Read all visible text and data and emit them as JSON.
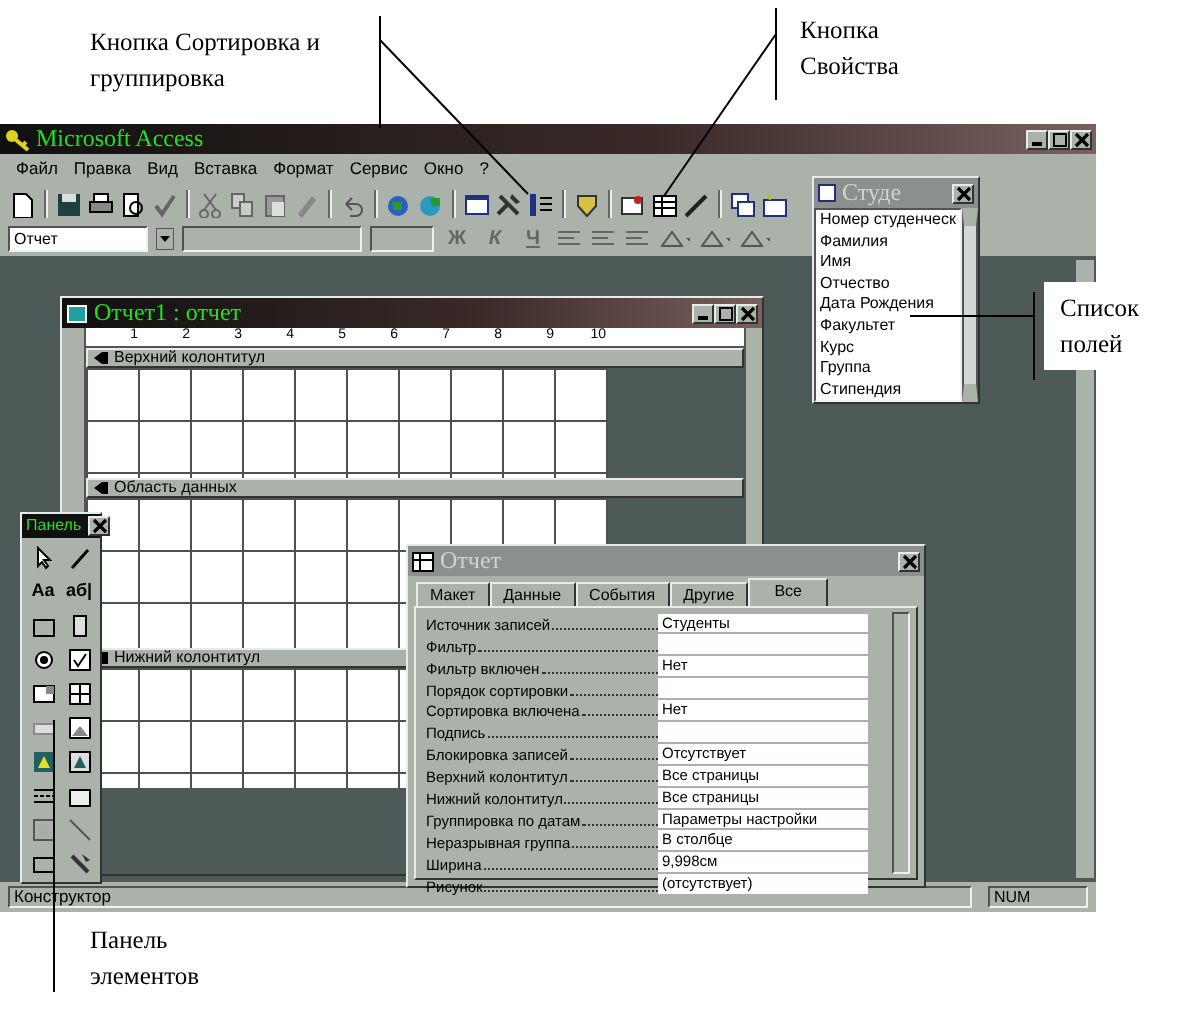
{
  "annotations": [
    {
      "kind": "sort",
      "text": "Кнопка Сортировка и группировка"
    },
    {
      "kind": "props",
      "text": "Кнопка Свойства"
    },
    {
      "kind": "fields",
      "text": "Список полей"
    },
    {
      "kind": "toolbox",
      "text": "Панель элементов"
    }
  ],
  "app_window": {
    "title": "Microsoft Access"
  },
  "menu": [
    "Файл",
    "Правка",
    "Вид",
    "Вставка",
    "Формат",
    "Сервис",
    "Окно",
    "?"
  ],
  "format_toolbar": {
    "object_combo": "Отчет",
    "style_buttons": [
      "Ж",
      "К",
      "Ч"
    ]
  },
  "report_window": {
    "title": "Отчет1 : отчет",
    "ruler": [
      "1",
      "2",
      "3",
      "4",
      "5",
      "6",
      "7",
      "8",
      "9",
      "10"
    ],
    "sections": [
      {
        "title": "Верхний колонтитул"
      },
      {
        "title": "Область данных"
      },
      {
        "title": "Нижний колонтитул"
      }
    ]
  },
  "field_list": {
    "title": "Студе",
    "items": [
      "Номер студенческ",
      "Фамилия",
      "Имя",
      "Отчество",
      "Дата Рождения",
      "Факультет",
      "Курс",
      "Группа",
      "Стипендия"
    ]
  },
  "toolbox": {
    "title": "Панель",
    "text_tools": [
      "Aa",
      "аб|"
    ]
  },
  "properties": {
    "title": "Отчет",
    "tabs": [
      {
        "label": "Макет",
        "selected": false
      },
      {
        "label": "Данные",
        "selected": false
      },
      {
        "label": "События",
        "selected": false
      },
      {
        "label": "Другие",
        "selected": false
      },
      {
        "label": "Все",
        "selected": true
      }
    ],
    "rows": [
      {
        "label": "Источник записей",
        "value": "Студенты"
      },
      {
        "label": "Фильтр"
      },
      {
        "label": "Фильтр включен",
        "value": "Нет"
      },
      {
        "label": "Порядок сортировки"
      },
      {
        "label": "Сортировка включена",
        "value": "Нет"
      },
      {
        "label": "Подпись"
      },
      {
        "label": "Блокировка записей",
        "value": "Отсутствует"
      },
      {
        "label": "Верхний колонтитул",
        "value": "Все страницы"
      },
      {
        "label": "Нижний колонтитул",
        "value": "Все страницы"
      },
      {
        "label": "Группировка по датам",
        "value": "Параметры настройки"
      },
      {
        "label": "Неразрывная группа",
        "value": "В столбце"
      },
      {
        "label": "Ширина",
        "value": "9,998см"
      },
      {
        "label": "Рисунок",
        "value": "(отсутствует)"
      }
    ]
  },
  "status_bar": {
    "mode": "Конструктор",
    "indicator": "NUM"
  }
}
